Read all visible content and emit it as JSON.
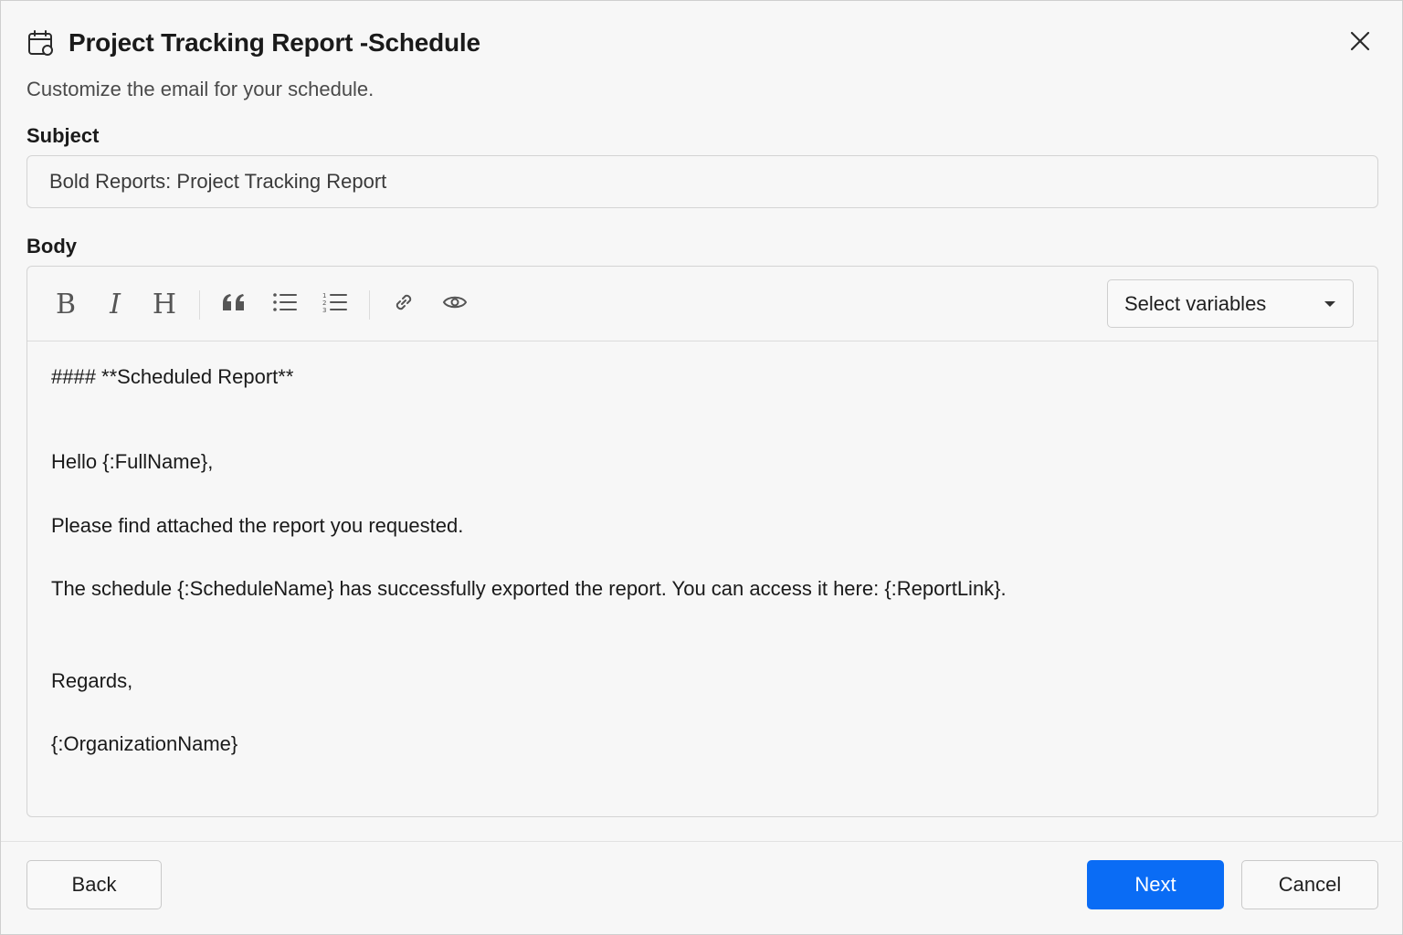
{
  "dialog": {
    "title": "Project Tracking Report -Schedule",
    "subtitle": "Customize the email for your schedule.",
    "close_icon": "close-icon",
    "title_icon": "calendar-clock-icon"
  },
  "subject": {
    "label": "Subject",
    "value": "Bold Reports: Project Tracking Report"
  },
  "body": {
    "label": "Body",
    "toolbar": {
      "tools": [
        "bold-icon",
        "italic-icon",
        "heading-icon",
        "quote-icon",
        "bullet-list-icon",
        "numbered-list-icon",
        "link-icon",
        "preview-icon"
      ],
      "select_variables": "Select variables"
    },
    "lines": [
      "#### **Scheduled Report**",
      "Hello {:FullName},",
      "Please find attached the report you requested.",
      "The schedule {:ScheduleName} has successfully exported the report. You can access it here: {:ReportLink}.",
      "Regards,",
      "{:OrganizationName}"
    ]
  },
  "footer": {
    "back_label": "Back",
    "next_label": "Next",
    "cancel_label": "Cancel"
  },
  "colors": {
    "primary": "#0a6cf5",
    "background": "#f7f7f7",
    "border": "#d4d4d4"
  }
}
